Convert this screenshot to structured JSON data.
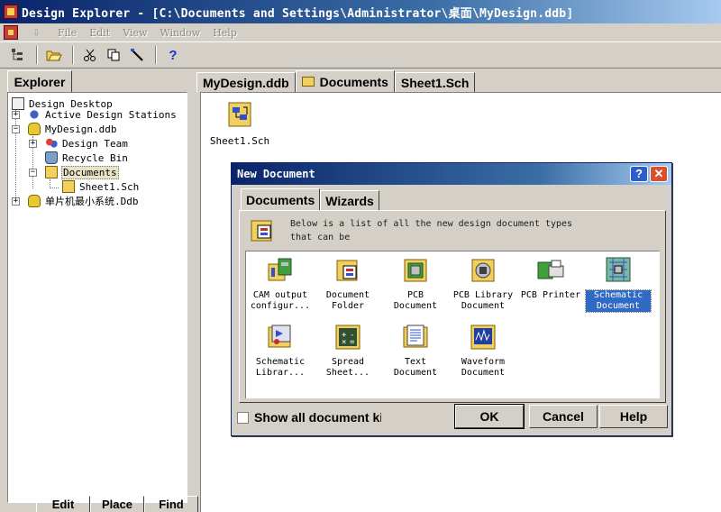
{
  "window": {
    "title": "Design Explorer - [C:\\Documents and Settings\\Administrator\\桌面\\MyDesign.ddb]"
  },
  "menu": {
    "items": [
      "File",
      "Edit",
      "View",
      "Window",
      "Help"
    ]
  },
  "toolbar": {
    "help_glyph": "?"
  },
  "explorer": {
    "tab_label": "Explorer",
    "tree": {
      "root": "Design Desktop",
      "items": [
        {
          "label": "Active Design Stations"
        },
        {
          "label": "MyDesign.ddb"
        },
        {
          "label": "Design Team"
        },
        {
          "label": "Recycle Bin"
        },
        {
          "label": "Documents"
        },
        {
          "label": "Sheet1.Sch"
        },
        {
          "label": "单片机最小系统.Ddb"
        }
      ]
    },
    "bottom_buttons": [
      "Edit",
      "Place",
      "Find"
    ]
  },
  "documents": {
    "tabs": [
      "MyDesign.ddb",
      "Documents",
      "Sheet1.Sch"
    ],
    "active_tab": "Documents",
    "files": [
      {
        "name": "Sheet1.Sch",
        "icon": "schematic-sheet-icon"
      }
    ]
  },
  "dialog": {
    "title": "New Document",
    "help_btn": "?",
    "close_btn": "✕",
    "tabs": [
      "Documents",
      "Wizards"
    ],
    "active_tab": "Documents",
    "info_text_1": "Below is a list of all the new design document types",
    "info_text_2": "that can be",
    "items": [
      {
        "line1": "CAM output",
        "line2": "configur...",
        "icon": "cam-output-icon"
      },
      {
        "line1": "Document",
        "line2": "Folder",
        "icon": "document-folder-icon"
      },
      {
        "line1": "PCB",
        "line2": "Document",
        "icon": "pcb-document-icon"
      },
      {
        "line1": "PCB Library",
        "line2": "Document",
        "icon": "pcb-library-icon"
      },
      {
        "line1": "PCB Printer",
        "line2": "",
        "icon": "pcb-printer-icon"
      },
      {
        "line1": "Schematic",
        "line2": "Document",
        "icon": "schematic-document-icon",
        "selected": true
      },
      {
        "line1": "Schematic",
        "line2": "Librar...",
        "icon": "schematic-library-icon"
      },
      {
        "line1": "Spread",
        "line2": "Sheet...",
        "icon": "spreadsheet-icon"
      },
      {
        "line1": "Text",
        "line2": "Document",
        "icon": "text-document-icon"
      },
      {
        "line1": "Waveform",
        "line2": "Document",
        "icon": "waveform-document-icon"
      }
    ],
    "show_all_label": "Show all document ki",
    "ok_label": "OK",
    "cancel_label": "Cancel",
    "help_label": "Help"
  },
  "colors": {
    "titlebar_start": "#0a246a",
    "titlebar_end": "#a6caf0",
    "selection": "#316ac5",
    "face": "#d4d0c8"
  }
}
